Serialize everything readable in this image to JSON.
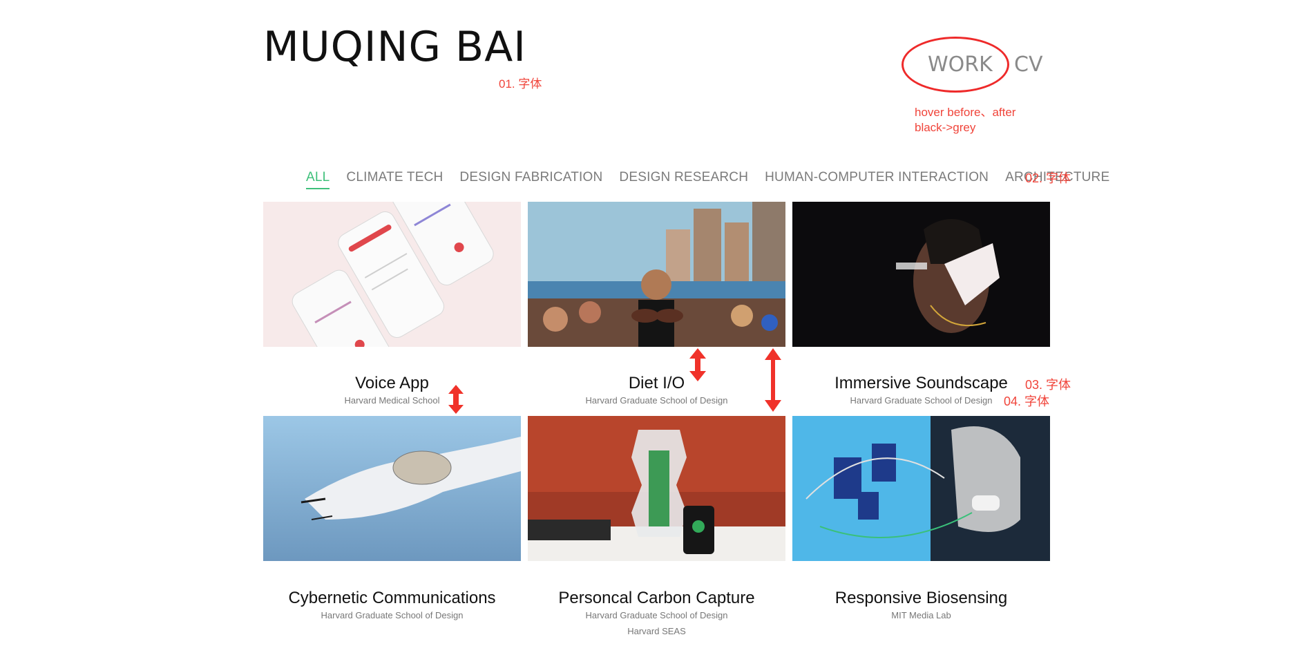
{
  "header": {
    "title": "MUQING BAI",
    "nav": {
      "work": "WORK",
      "cv": "CV"
    }
  },
  "annotations": {
    "a1": "01. 字体",
    "a2": "02. 字体",
    "a3": "03. 字体",
    "a4": "04. 字体",
    "hover_line1": "hover before、after",
    "hover_line2": "black->grey"
  },
  "filters": [
    {
      "label": "ALL",
      "active": true
    },
    {
      "label": "CLIMATE TECH"
    },
    {
      "label": "DESIGN FABRICATION"
    },
    {
      "label": "DESIGN RESEARCH"
    },
    {
      "label": "HUMAN-COMPUTER INTERACTION"
    },
    {
      "label": "ARCHITECTURE"
    }
  ],
  "projects": [
    {
      "title": "Voice App",
      "subtitle": "Harvard Medical School",
      "extra": ""
    },
    {
      "title": "Diet I/O",
      "subtitle": "Harvard Graduate School of Design",
      "extra": ""
    },
    {
      "title": "Immersive Soundscape",
      "subtitle": "Harvard Graduate School of Design",
      "extra": ""
    },
    {
      "title": "Cybernetic Communications",
      "subtitle": "Harvard Graduate School of Design",
      "extra": ""
    },
    {
      "title": "Personcal Carbon Capture",
      "subtitle": "Harvard Graduate School of Design",
      "extra": "Harvard SEAS"
    },
    {
      "title": "Responsive Biosensing",
      "subtitle": "MIT Media Lab",
      "extra": ""
    }
  ],
  "colors": {
    "accent_green": "#3ec07a",
    "annotation_red": "#f0443a",
    "nav_grey": "#8a8a8a"
  }
}
